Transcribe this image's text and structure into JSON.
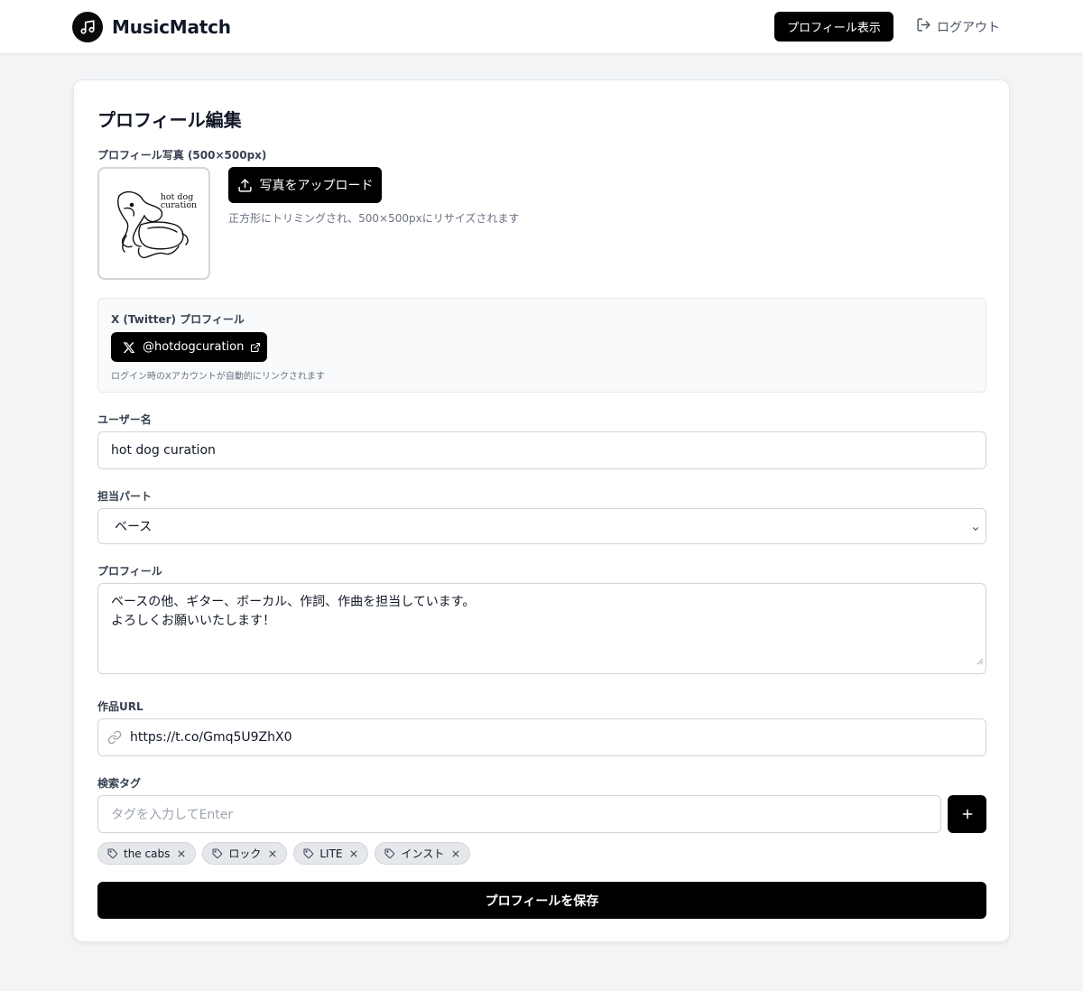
{
  "header": {
    "brand_name": "MusicMatch",
    "view_profile_label": "プロフィール表示",
    "logout_label": "ログアウト"
  },
  "form": {
    "title": "プロフィール編集",
    "photo": {
      "label": "プロフィール写真 (500×500px)",
      "upload_label": "写真をアップロード",
      "hint": "正方形にトリミングされ、500×500pxにリサイズされます",
      "image_text_line1": "hot dog",
      "image_text_line2": "curation"
    },
    "x_profile": {
      "label": "X (Twitter) プロフィール",
      "handle": "@hotdogcuration",
      "hint": "ログイン時のXアカウントが自動的にリンクされます"
    },
    "username": {
      "label": "ユーザー名",
      "value": "hot dog curation"
    },
    "part": {
      "label": "担当パート",
      "selected": "ベース"
    },
    "profile": {
      "label": "プロフィール",
      "line1": "ベースの他、ギター、ボーカル、作詞、作曲を担当しています。",
      "line2": "よろしくお願いいたします！"
    },
    "works_url": {
      "label": "作品URL",
      "value": "https://t.co/Gmq5U9ZhX0"
    },
    "tags": {
      "label": "検索タグ",
      "placeholder": "タグを入力してEnter",
      "items": [
        "the cabs",
        "ロック",
        "LITE",
        "インスト"
      ]
    },
    "save_label": "プロフィールを保存"
  },
  "colors": {
    "primary": "#000000",
    "background": "#f3f4f6",
    "card": "#ffffff",
    "tag_bg": "#e5e7eb"
  }
}
